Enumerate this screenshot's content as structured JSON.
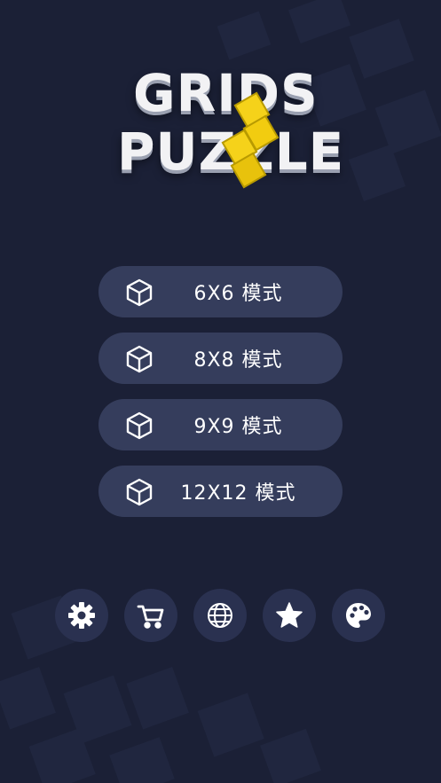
{
  "logo": {
    "line1": "GRIDS",
    "line2": "PUZZLE",
    "icon": "yellow-tetromino-icon"
  },
  "modes": [
    {
      "label": "6X6 模式",
      "icon": "cube-icon"
    },
    {
      "label": "8X8 模式",
      "icon": "cube-icon"
    },
    {
      "label": "9X9 模式",
      "icon": "cube-icon"
    },
    {
      "label": "12X12 模式",
      "icon": "cube-icon"
    }
  ],
  "toolbar": [
    {
      "name": "settings",
      "icon": "gear-icon"
    },
    {
      "name": "shop",
      "icon": "cart-icon"
    },
    {
      "name": "language",
      "icon": "globe-icon"
    },
    {
      "name": "favorites",
      "icon": "star-icon"
    },
    {
      "name": "theme",
      "icon": "palette-icon"
    }
  ],
  "colors": {
    "background": "#1b2036",
    "button": "#353d5c",
    "tool_button": "#2a3150",
    "logo_yellow": "#f5d21a",
    "text": "#ffffff"
  }
}
